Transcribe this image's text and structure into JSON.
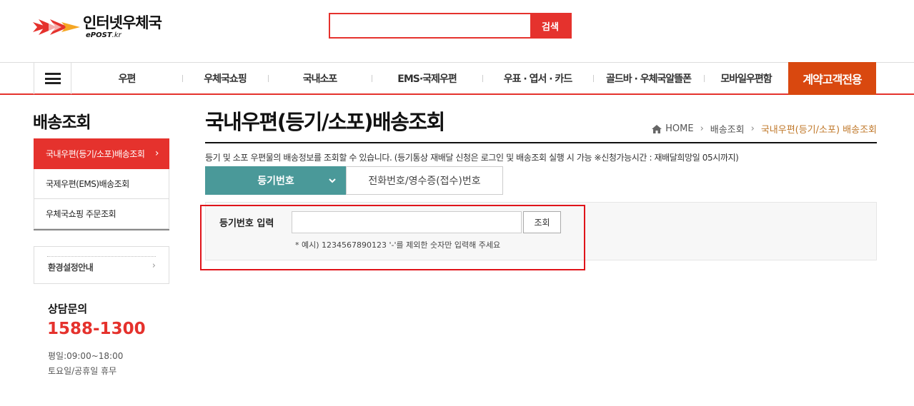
{
  "header": {
    "logo_text": "인터넷우체국",
    "logo_sub": "ePOST",
    "logo_sub_suffix": ".kr",
    "search_placeholder": "",
    "search_button": "검색"
  },
  "gnb": {
    "items": [
      "우편",
      "우체국쇼핑",
      "국내소포",
      "EMS·국제우편",
      "우표 · 엽서 · 카드",
      "골드바 · 우체국알뜰폰",
      "모바일우편함"
    ],
    "contract": "계약고객전용"
  },
  "lnb": {
    "title": "배송조회",
    "items": [
      "국내우편(등기/소포)배송조회",
      "국제우편(EMS)배송조회",
      "우체국쇼핑 주문조회"
    ],
    "env": "환경설정안내"
  },
  "contact": {
    "title": "상담문의",
    "phone": "1588-1300",
    "hours_weekday": "평일:09:00~18:00",
    "hours_weekend": "토요일/공휴일 휴무"
  },
  "main": {
    "title": "국내우편(등기/소포)배송조회",
    "breadcrumb": [
      "HOME",
      "배송조회",
      "국내우편(등기/소포) 배송조회"
    ],
    "description": "등기 및 소포 우편물의 배송정보를 조회할 수 있습니다. (등기통상 재배달 신청은 로그인 및 배송조회 실행 시 가능 ※신청가능시간 : 재배달희망일 05시까지)",
    "tabs": [
      "등기번호",
      "전화번호/영수증(접수)번호"
    ],
    "field_label": "등기번호 입력",
    "field_value": "",
    "search_button": "조회",
    "hint": "* 예시) 1234567890123 '-'를 제외한 숫자만 입력해 주세요"
  },
  "colors": {
    "brand_red": "#e5322d",
    "contract_orange": "#d9480f",
    "tab_teal": "#4a9999",
    "breadcrumb_current": "#c0782a"
  }
}
